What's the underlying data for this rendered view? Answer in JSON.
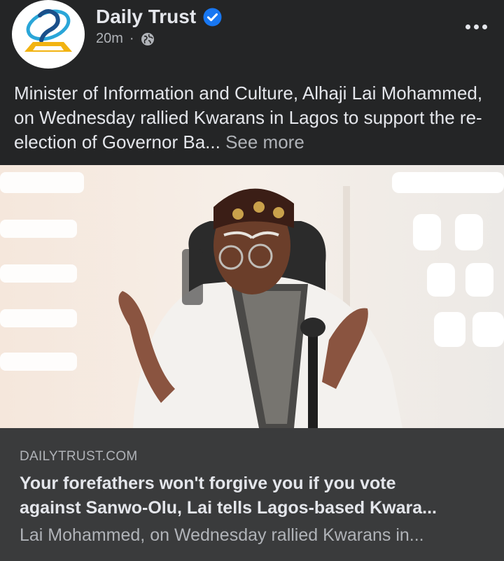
{
  "post": {
    "page_name": "Daily Trust",
    "timestamp": "20m",
    "separator": "·",
    "audience_icon": "globe-icon",
    "verified_icon": "verified-badge-icon",
    "more_icon": "more-options-icon",
    "text": "Minister of Information and Culture, Alhaji Lai Mohammed, on Wednesday rallied Kwarans in Lagos to support the re-election of Governor Ba...",
    "see_more": "See more"
  },
  "link_preview": {
    "domain": "DAILYTRUST.COM",
    "title_line1": "Your forefathers won't forgive you if you vote",
    "title_line2": "against Sanwo-Olu, Lai tells Lagos-based Kwara...",
    "description": "Lai Mohammed, on Wednesday rallied Kwarans in..."
  },
  "colors": {
    "background": "#242526",
    "card": "#3a3b3c",
    "primary_text": "#e4e6eb",
    "secondary_text": "#b0b3b8",
    "verified_blue": "#1877f2"
  }
}
